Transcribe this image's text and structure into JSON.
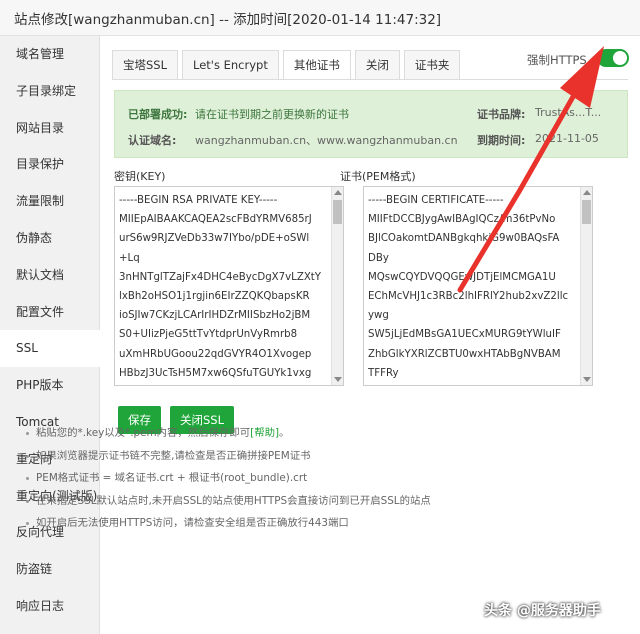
{
  "window": {
    "title": "站点修改[wangzhanmuban.cn] -- 添加时间[2020-01-14 11:47:32]"
  },
  "sidebar": {
    "items": [
      {
        "label": "域名管理"
      },
      {
        "label": "子目录绑定"
      },
      {
        "label": "网站目录"
      },
      {
        "label": "目录保护"
      },
      {
        "label": "流量限制"
      },
      {
        "label": "伪静态"
      },
      {
        "label": "默认文档"
      },
      {
        "label": "配置文件"
      },
      {
        "label": "SSL"
      },
      {
        "label": "PHP版本"
      },
      {
        "label": "Tomcat"
      },
      {
        "label": "重定向"
      },
      {
        "label": "重定向(测试版)"
      },
      {
        "label": "反向代理"
      },
      {
        "label": "防盗链"
      },
      {
        "label": "响应日志"
      }
    ]
  },
  "tabs": [
    {
      "label": "宝塔SSL"
    },
    {
      "label": "Let's Encrypt"
    },
    {
      "label": "其他证书"
    },
    {
      "label": "关闭"
    },
    {
      "label": "证书夹"
    }
  ],
  "force_https": {
    "label": "强制HTTPS",
    "enabled": true
  },
  "info": {
    "status_label": "已部署成功:",
    "status_text": "请在证书到期之前更换新的证书",
    "domains_label": "认证域名:",
    "domains_value": "wangzhanmuban.cn、www.wangzhanmuban.cn",
    "brand_label": "证书品牌:",
    "brand_value": "TrustAs...T...",
    "expiry_label": "到期时间:",
    "expiry_value": "2021-11-05"
  },
  "key": {
    "label": "密钥(KEY)",
    "content": "-----BEGIN RSA PRIVATE KEY-----\nMIIEpAIBAAKCAQEA2scFBdYRMV685rJ\nurS6w9RJZVeDb33w7IYbo/pDE+oSWl\n+Lq\n3nHNTglTZajFx4DHC4eBycDgX7vLZXtY\nlxBh2oHSO1j1rgjin6EIrZZQKQbapsKR\nioSJIw7CKzjLCArIrIHDZrMIISbzHo2jBM\nS0+UIizPjeG5ttTvYtdprUnVyRmrb8\nuXmHRbUGoou22qdGVYR4O1Xvogep\nHBbzJ3UcTsH5M7xw6QSfuTGUYk1vxg"
  },
  "cert": {
    "label": "证书(PEM格式)",
    "content": "-----BEGIN CERTIFICATE-----\nMIIFtDCCBJygAwIBAgIQCz/m36tPvNo\nBJlCOakomtDANBgkqhkiG9w0BAQsFA\nDBy\nMQswCQYDVQQGEwJDTjElMCMGA1U\nEChMcVHJ1c3RBc2lhIFRlY2hub2xvZ2llc\nywg\nSW5jLjEdMBsGA1UECxMURG9tYWluIF\nZhbGlkYXRlZCBTU0wxHTAbBgNVBAM\nTFFRy"
  },
  "buttons": {
    "save": "保存",
    "close_ssl": "关闭SSL"
  },
  "tips": {
    "t1_text": "粘贴您的*.key以及*.pem内容，然后保存即可",
    "t1_help": "[帮助]",
    "t1_end": "。",
    "t2": "如果浏览器提示证书链不完整,请检查是否正确拼接PEM证书",
    "t3": "PEM格式证书 = 域名证书.crt + 根证书(root_bundle).crt",
    "t4": "在未指定SSL默认站点时,未开启SSL的站点使用HTTPS会直接访问到已开启SSL的站点",
    "t5": "如开启后无法使用HTTPS访问，请检查安全组是否正确放行443端口"
  },
  "watermark": "头条 @服务器助手",
  "colors": {
    "accent": "#20a53a",
    "annotation_arrow": "#e8322b"
  }
}
